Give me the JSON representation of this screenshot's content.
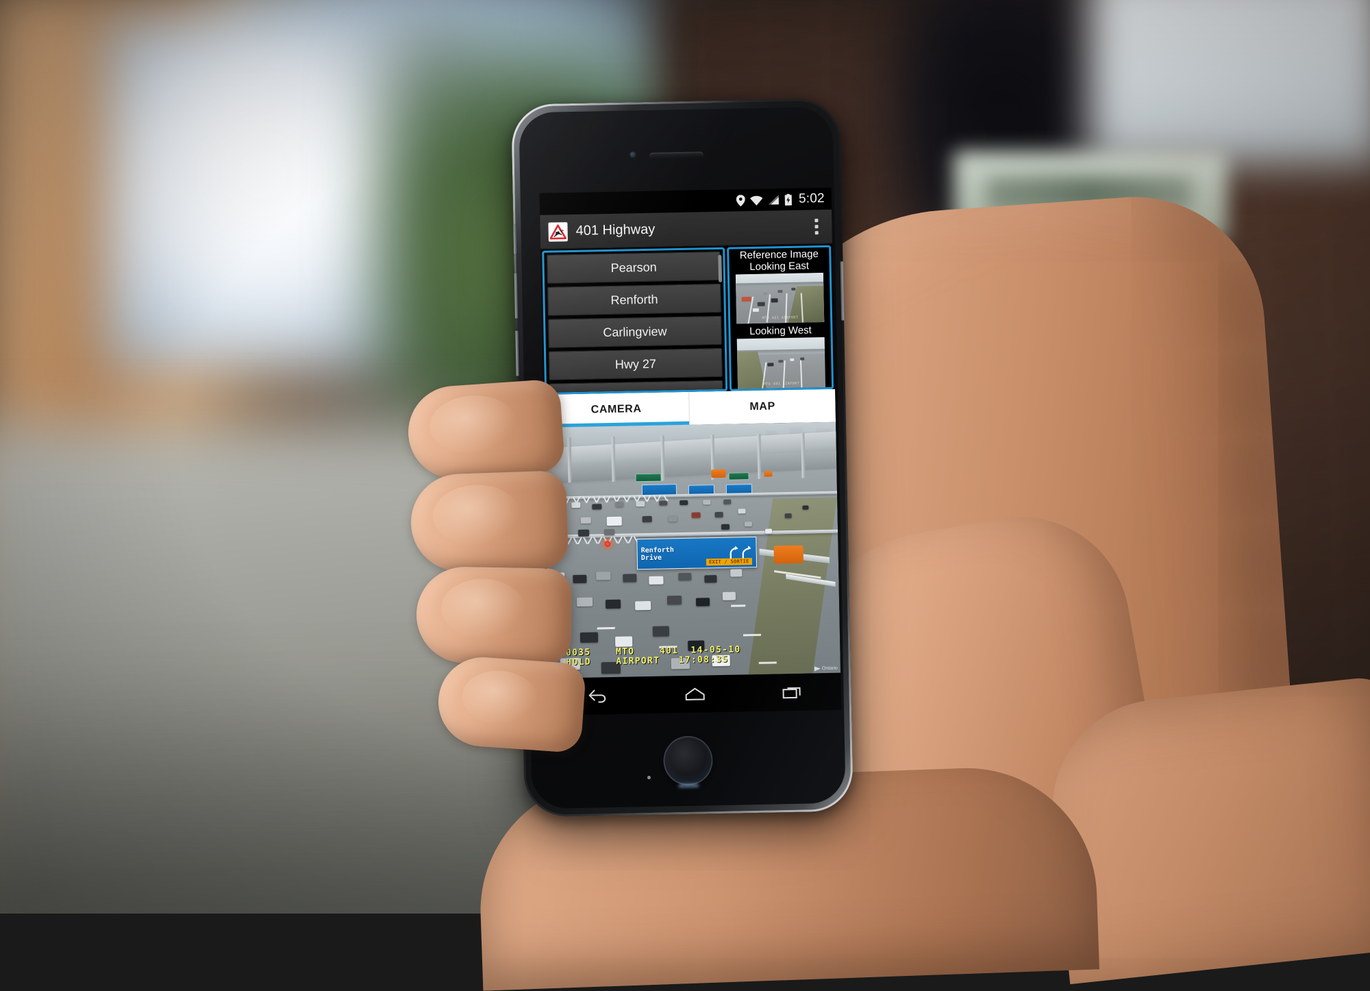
{
  "scene": {
    "description": "hand holding smartphone outdoors",
    "background_colors": {
      "left_wall": "#c79a6c",
      "ground": "#96978f",
      "brick_wall": "#4a332a",
      "foliage": "#5d7a43"
    },
    "skin_tone": "#dca983"
  },
  "device": {
    "body_color": "#16171a",
    "rim_color": "#989ca0"
  },
  "status_bar": {
    "time": "5:02",
    "icons": [
      "location-pin-icon",
      "wifi-icon",
      "cell-signal-icon",
      "battery-charging-icon"
    ],
    "background": "#000000"
  },
  "action_bar": {
    "title": "401 Highway",
    "app_icon": "slippery-road-warning-icon",
    "overflow_icon": "overflow-menu-icon",
    "background": "#2b2b2b"
  },
  "accent_color": "#1f93cf",
  "list_panel": {
    "border_color": "#1f93cf",
    "items": [
      {
        "label": "Pearson"
      },
      {
        "label": "Renforth"
      },
      {
        "label": "Carlingview"
      },
      {
        "label": "Hwy 27"
      }
    ],
    "has_scrollbar": true
  },
  "reference_panel": {
    "border_color": "#1f93cf",
    "title_line1": "Reference Image",
    "title_line2": "Looking East",
    "second_label": "Looking West",
    "east_thumb_timestamp": "MTO 401 AIRPORT",
    "west_thumb_timestamp": "MTO 401 AIRPORT"
  },
  "tabs": [
    {
      "label": "CAMERA",
      "active": true
    },
    {
      "label": "MAP",
      "active": false
    }
  ],
  "camera_view": {
    "highway_sign": {
      "text": "Renforth\nDrive",
      "exit_tag": "EXIT / SORTIE",
      "color": "#1877c4",
      "tag_color": "#f0a500"
    },
    "overlay_line1": "0035    MTO    401  14-05-10",
    "overlay_line2": "HOLD    AIRPORT   17:08:35",
    "overlay_color": "#f3f35a",
    "watermark": "Ontario"
  },
  "nav_bar": {
    "buttons": [
      "back-icon",
      "home-icon",
      "recents-icon"
    ],
    "background": "#000000"
  }
}
